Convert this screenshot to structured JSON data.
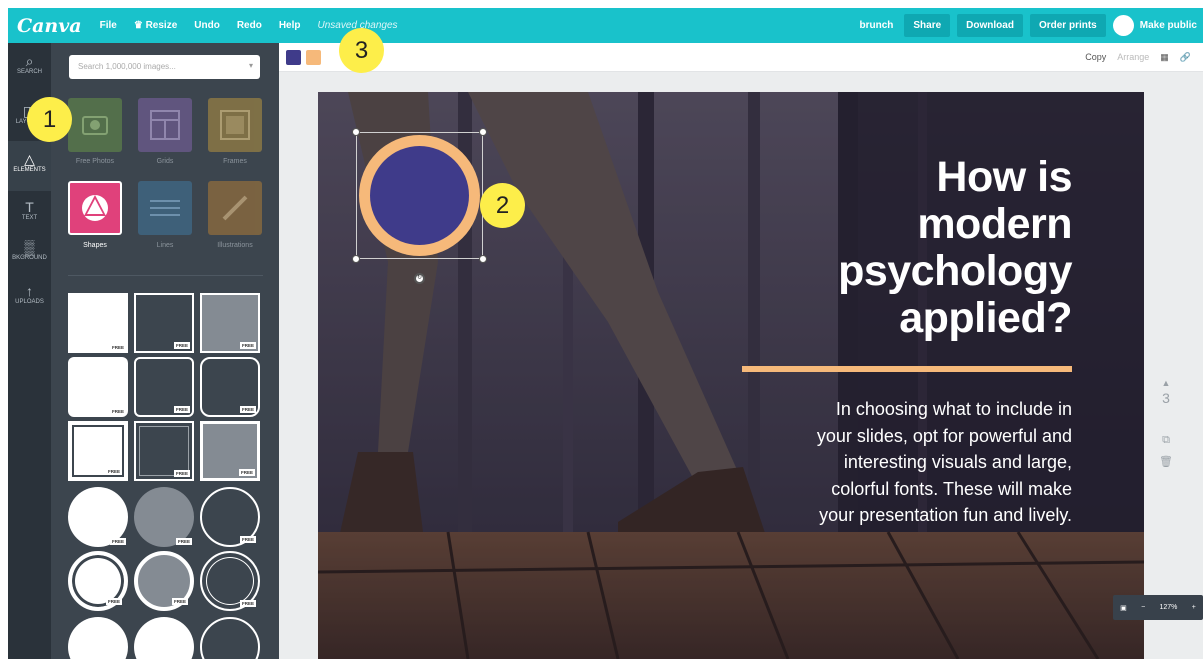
{
  "topbar": {
    "logo": "Canva",
    "menu": [
      "File",
      "♛ Resize",
      "Undo",
      "Redo",
      "Help"
    ],
    "status": "Unsaved changes",
    "doc_name": "brunch",
    "share": "Share",
    "download": "Download",
    "order": "Order prints",
    "make_public": "Make public"
  },
  "sidebar": {
    "items": [
      {
        "label": "SEARCH",
        "icon": "⌕"
      },
      {
        "label": "LAYOUTS",
        "icon": "◫"
      },
      {
        "label": "ELEMENTS",
        "icon": "△"
      },
      {
        "label": "TEXT",
        "icon": "T"
      },
      {
        "label": "BKGROUND",
        "icon": "▒"
      },
      {
        "label": "UPLOADS",
        "icon": "↑"
      }
    ]
  },
  "panel": {
    "search_placeholder": "Search 1,000,000 images...",
    "categories": [
      "Free Photos",
      "Grids",
      "Frames",
      "Shapes",
      "Lines",
      "Illustrations"
    ],
    "free_tag": "FREE"
  },
  "toolbar": {
    "colors": [
      "#3f3b8a",
      "#f6b97a"
    ],
    "copy": "Copy",
    "arrange": "Arrange"
  },
  "slide": {
    "title": [
      "How is",
      "modern",
      "psychology",
      "applied?"
    ],
    "body": [
      "In choosing what to include in",
      "your slides, opt for powerful and",
      "interesting visuals and large,",
      "colorful fonts. These will make",
      "your presentation fun and lively."
    ],
    "accent": "#f6b97a",
    "circle_fill": "#3f3b8a"
  },
  "page_number": "3",
  "zoom": "127%",
  "callouts": [
    "1",
    "2",
    "3"
  ]
}
